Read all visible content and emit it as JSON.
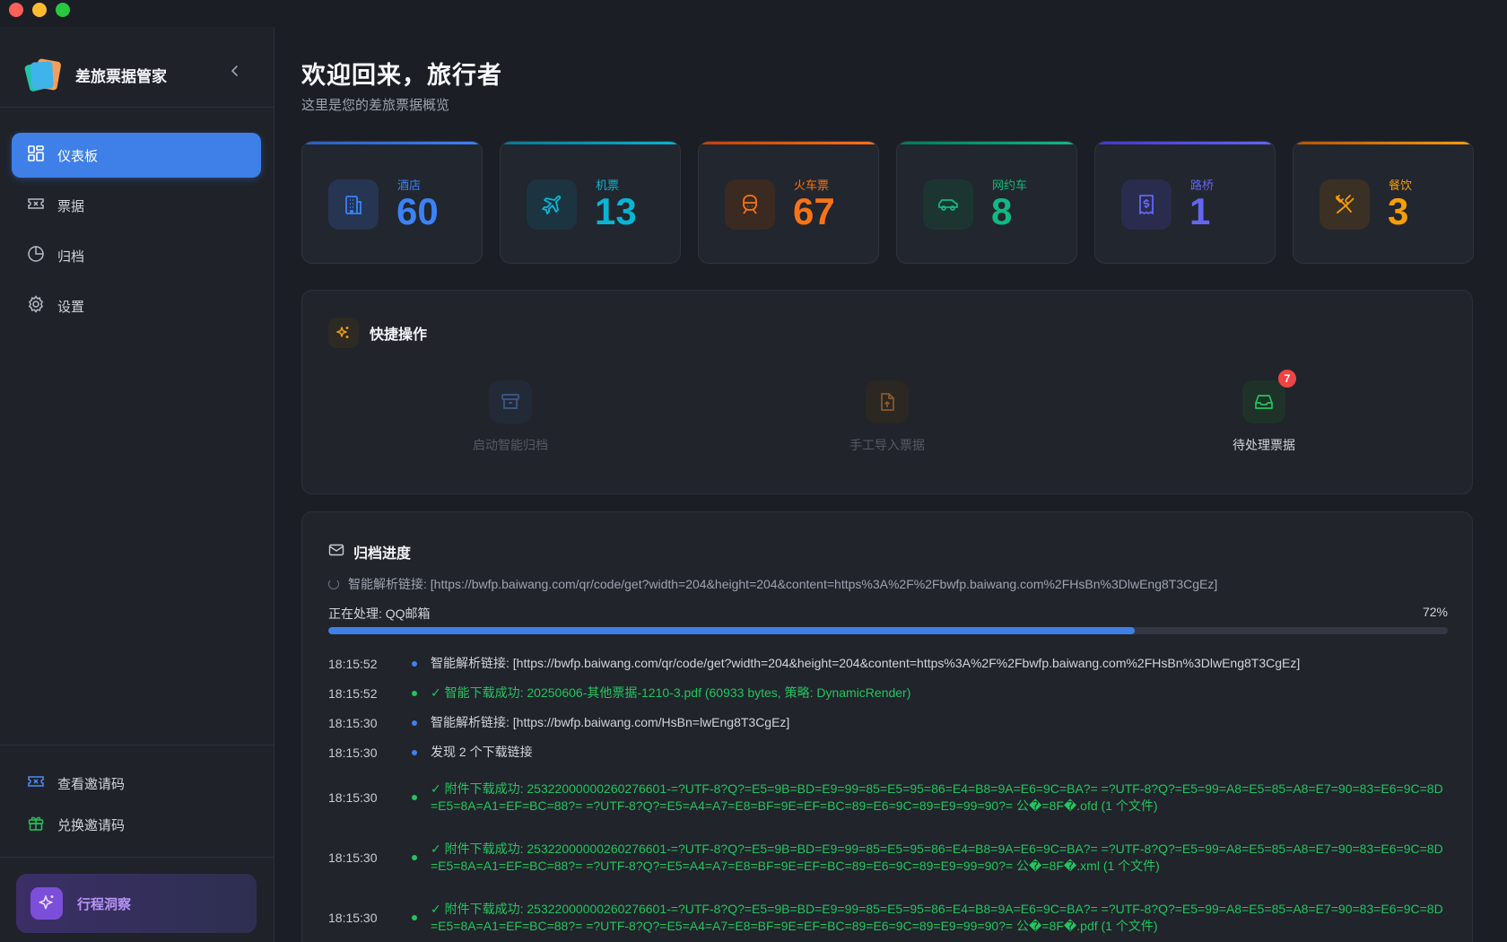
{
  "app": {
    "title": "差旅票据管家",
    "collapse_icon": "chevron-left-icon"
  },
  "sidebar": {
    "items": [
      {
        "label": "仪表板",
        "icon": "dashboard-grid-icon",
        "active": true
      },
      {
        "label": "票据",
        "icon": "ticket-icon",
        "active": false
      },
      {
        "label": "归档",
        "icon": "pie-chart-icon",
        "active": false
      },
      {
        "label": "设置",
        "icon": "gear-icon",
        "active": false
      }
    ],
    "bottom": [
      {
        "label": "查看邀请码",
        "icon": "ticket-icon"
      },
      {
        "label": "兑换邀请码",
        "icon": "gift-icon"
      }
    ],
    "insight": {
      "label": "行程洞察",
      "icon": "sparkles-icon"
    }
  },
  "header": {
    "title": "欢迎回来，旅行者",
    "subtitle": "这里是您的差旅票据概览"
  },
  "stats": [
    {
      "label": "酒店",
      "value": "60",
      "icon": "building-icon",
      "color": "#3b82f6"
    },
    {
      "label": "机票",
      "value": "13",
      "icon": "plane-icon",
      "color": "#06b6d4"
    },
    {
      "label": "火车票",
      "value": "67",
      "icon": "train-icon",
      "color": "#f97316"
    },
    {
      "label": "网约车",
      "value": "8",
      "icon": "car-icon",
      "color": "#10b981"
    },
    {
      "label": "路桥",
      "value": "1",
      "icon": "receipt-icon",
      "color": "#6366f1"
    },
    {
      "label": "餐饮",
      "value": "3",
      "icon": "utensils-icon",
      "color": "#f59e0b"
    }
  ],
  "quick_actions": {
    "title": "快捷操作",
    "icon": "sparkles-icon",
    "items": [
      {
        "label": "启动智能归档",
        "icon": "archive-icon",
        "enabled": false
      },
      {
        "label": "手工导入票据",
        "icon": "file-upload-icon",
        "enabled": false
      },
      {
        "label": "待处理票据",
        "icon": "inbox-icon",
        "enabled": true,
        "badge": "7"
      }
    ]
  },
  "archive_progress": {
    "title": "归档进度",
    "icon": "mail-icon",
    "status": "智能解析链接: [https://bwfp.baiwang.com/qr/code/get?width=204&height=204&content=https%3A%2F%2Fbwfp.baiwang.com%2FHsBn%3DlwEng8T3CgEz]",
    "processing": "正在处理: QQ邮箱",
    "percent_label": "72%",
    "percent": 0.72,
    "logs": [
      {
        "time": "18:15:52",
        "type": "info",
        "message": "智能解析链接: [https://bwfp.baiwang.com/qr/code/get?width=204&height=204&content=https%3A%2F%2Fbwfp.baiwang.com%2FHsBn%3DlwEng8T3CgEz]"
      },
      {
        "time": "18:15:52",
        "type": "ok",
        "message": "✓ 智能下载成功: 20250606-其他票据-1210-3.pdf (60933 bytes, 策略: DynamicRender)"
      },
      {
        "time": "18:15:30",
        "type": "info",
        "message": "智能解析链接: [https://bwfp.baiwang.com/HsBn=lwEng8T3CgEz]"
      },
      {
        "time": "18:15:30",
        "type": "info",
        "message": "发现 2 个下载链接"
      },
      {
        "time": "18:15:30",
        "type": "ok",
        "message": "✓ 附件下载成功: 25322000000260276601-=?UTF-8?Q?=E5=9B=BD=E9=99=85=E5=95=86=E4=B8=9A=E6=9C=BA?= =?UTF-8?Q?=E5=99=A8=E5=85=A8=E7=90=83=E6=9C=8D=E5=8A=A1=EF=BC=88?= =?UTF-8?Q?=E5=A4=A7=E8=BF=9E=EF=BC=89=E6=9C=89=E9=99=90?= 公�=8F�.ofd (1 个文件)"
      },
      {
        "time": "18:15:30",
        "type": "ok",
        "message": "✓ 附件下载成功: 25322000000260276601-=?UTF-8?Q?=E5=9B=BD=E9=99=85=E5=95=86=E4=B8=9A=E6=9C=BA?= =?UTF-8?Q?=E5=99=A8=E5=85=A8=E7=90=83=E6=9C=8D=E5=8A=A1=EF=BC=88?= =?UTF-8?Q?=E5=A4=A7=E8=BF=9E=EF=BC=89=E6=9C=89=E9=99=90?= 公�=8F�.xml (1 个文件)"
      },
      {
        "time": "18:15:30",
        "type": "ok",
        "message": "✓ 附件下载成功: 25322000000260276601-=?UTF-8?Q?=E5=9B=BD=E9=99=85=E5=95=86=E4=B8=9A=E6=9C=BA?= =?UTF-8?Q?=E5=99=A8=E5=85=A8=E7=90=83=E6=9C=8D=E5=8A=A1=EF=BC=88?= =?UTF-8?Q?=E5=A4=A7=E8=BF=9E=EF=BC=89=E6=9C=89=E9=99=90?= 公�=8F�.pdf (1 个文件)"
      }
    ]
  }
}
